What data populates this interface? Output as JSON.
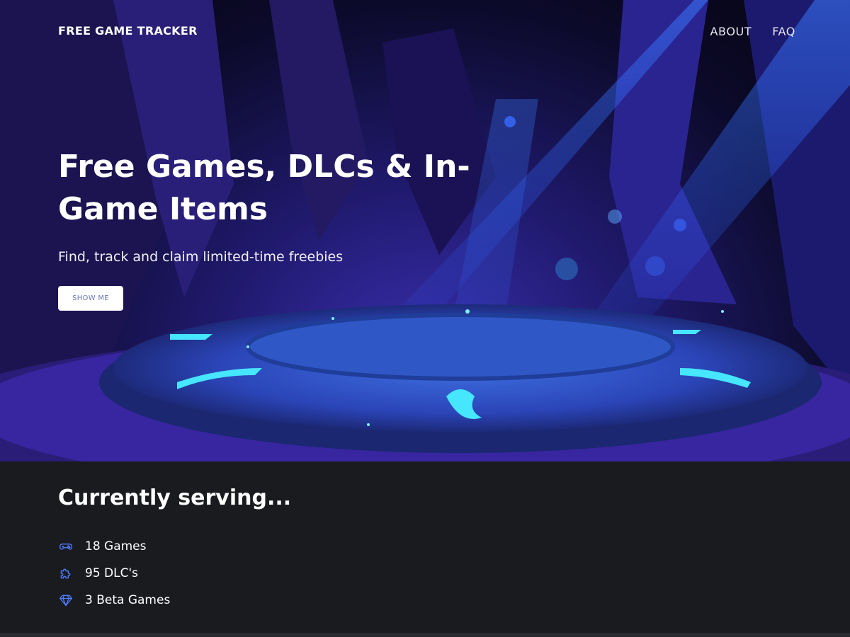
{
  "header": {
    "brand": "FREE GAME TRACKER",
    "nav": [
      {
        "label": "ABOUT"
      },
      {
        "label": "FAQ"
      }
    ]
  },
  "hero": {
    "title": "Free Games, DLCs & In-Game Items",
    "subtitle": "Find, track and claim limited-time freebies",
    "cta_label": "SHOW ME"
  },
  "stats": {
    "title": "Currently serving...",
    "items": [
      {
        "icon": "gamepad-icon",
        "label": "18 Games"
      },
      {
        "icon": "puzzle-icon",
        "label": "95 DLC's"
      },
      {
        "icon": "diamond-icon",
        "label": "3 Beta Games"
      }
    ]
  },
  "colors": {
    "accent": "#4f7cff",
    "background": "#1a1b1f",
    "button_text": "#6b74b8"
  }
}
